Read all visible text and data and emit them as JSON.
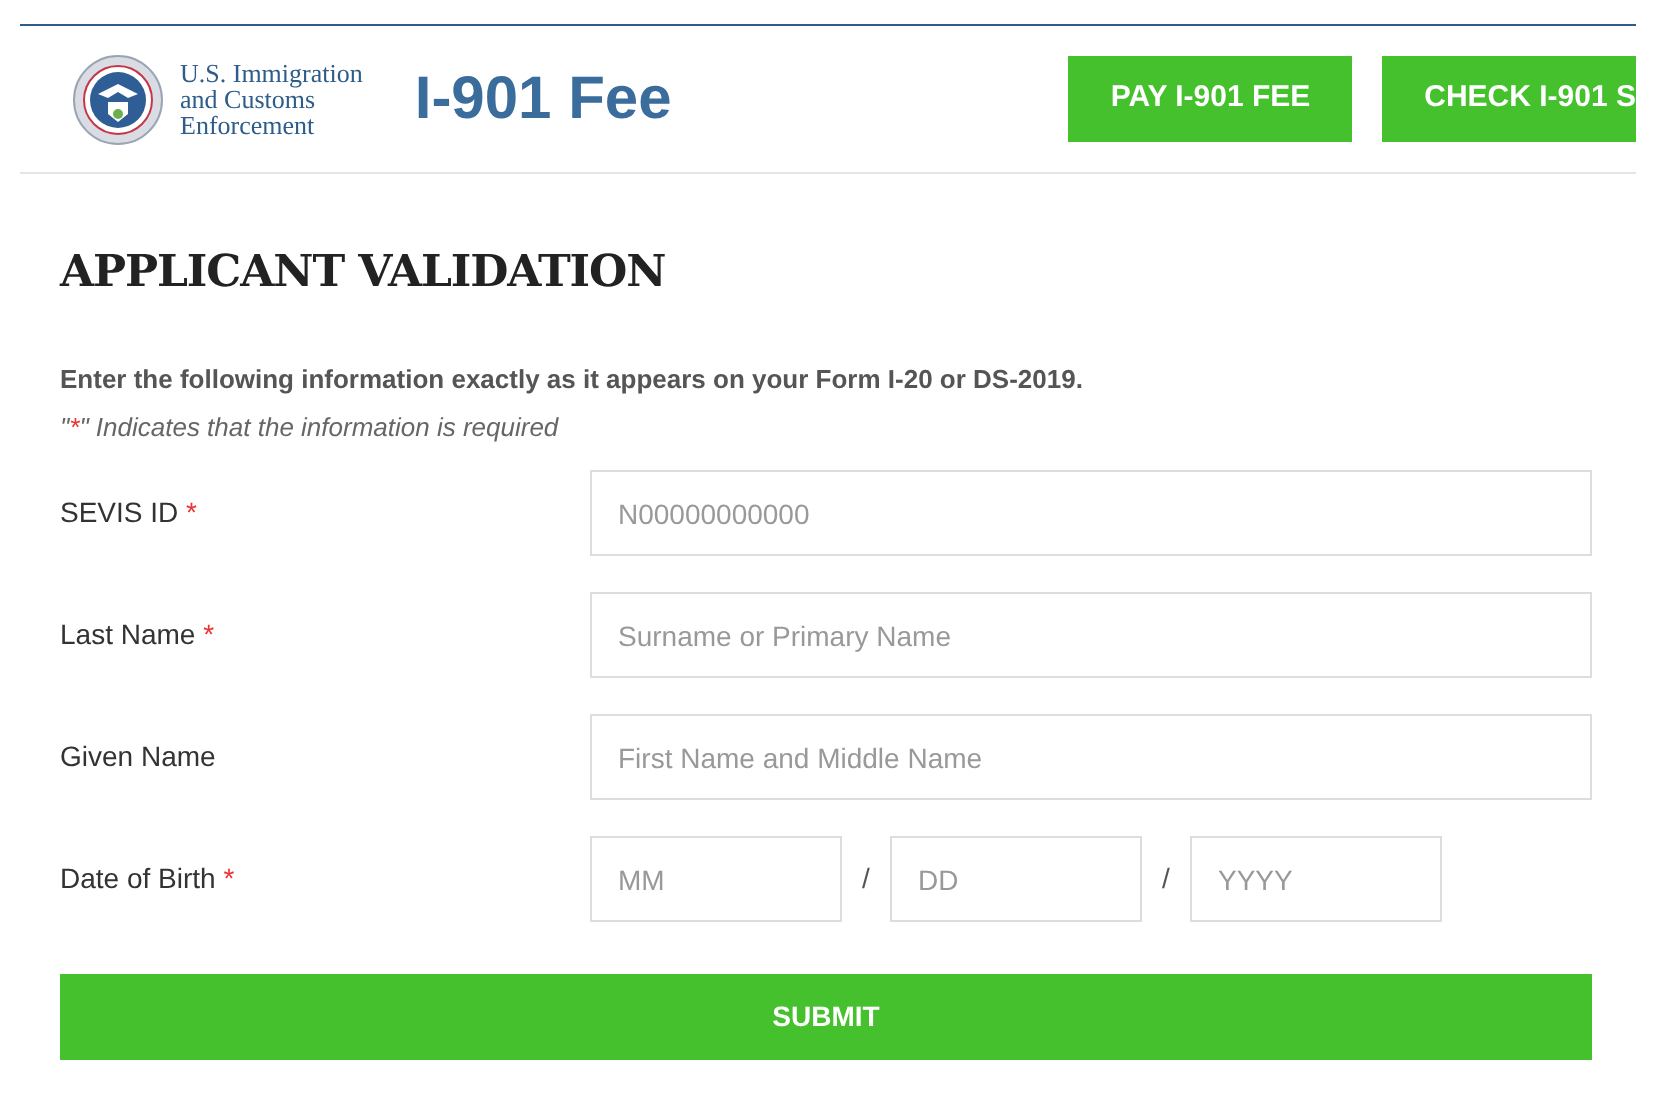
{
  "header": {
    "agency": [
      "U.S. Immigration",
      "and Customs",
      "Enforcement"
    ],
    "title": "I-901 Fee",
    "buttons": [
      "PAY I-901 FEE",
      "CHECK I-901 S"
    ]
  },
  "heading": "APPLICANT VALIDATION",
  "instructions": "Enter the following information exactly as it appears on your Form I-20 or DS-2019.",
  "note": {
    "open": "\"",
    "mark": "*",
    "rest": "\" Indicates that the information is required"
  },
  "fields": [
    {
      "kind": "text",
      "label": "SEVIS ID",
      "required": true,
      "placeholder": "N00000000000"
    },
    {
      "kind": "text",
      "label": "Last Name",
      "required": true,
      "placeholder": "Surname or Primary Name"
    },
    {
      "kind": "text",
      "label": "Given Name",
      "required": false,
      "placeholder": "First Name and Middle Name"
    },
    {
      "kind": "date",
      "label": "Date of Birth",
      "required": true,
      "parts": [
        {
          "placeholder": "MM"
        },
        {
          "placeholder": "DD"
        },
        {
          "placeholder": "YYYY"
        }
      ],
      "separators": [
        "/",
        "/"
      ]
    }
  ],
  "submit": "SUBMIT"
}
